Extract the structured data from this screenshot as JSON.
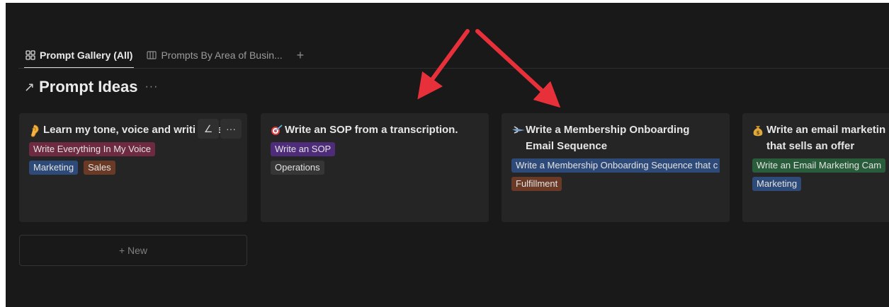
{
  "tabs": [
    {
      "label": "Prompt Gallery (All)",
      "icon": "gallery-icon",
      "active": true
    },
    {
      "label": "Prompts By Area of Busin...",
      "icon": "board-icon",
      "active": false
    }
  ],
  "add_tab_label": "+",
  "view_title": "Prompt Ideas",
  "view_title_icon": "↗",
  "view_more": "···",
  "cards": [
    {
      "emoji": "ear-icon",
      "title": "Learn my tone, voice and writi style",
      "tags": [
        [
          "Write Everything In My Voice"
        ],
        [
          "Marketing",
          "Sales"
        ]
      ]
    },
    {
      "emoji": "target-icon",
      "title": "Write an SOP from a transcription.",
      "tags": [
        [
          "Write an SOP"
        ],
        [
          "Operations"
        ]
      ]
    },
    {
      "emoji": "flying-icon",
      "title": "Write a Membership Onboarding Email Sequence",
      "tags": [
        [
          "Write a Membership Onboarding Sequence that c"
        ],
        [
          "Fulfillment"
        ]
      ]
    },
    {
      "emoji": "money-bag-icon",
      "title": "Write an email marketin that sells an offer",
      "tags": [
        [
          "Write an Email Marketing Cam"
        ],
        [
          "Marketing"
        ]
      ]
    }
  ],
  "card_actions": {
    "edit": "∠",
    "more": "···"
  },
  "new_button_label": "+ New",
  "colors": {
    "background": "#191919",
    "card": "#252525",
    "arrow": "#e8303a",
    "tag_red": "#6e2a40",
    "tag_blue": "#2d4a78",
    "tag_brown": "#6b3a27",
    "tag_purple": "#4e2c7a",
    "tag_gray": "#363636",
    "tag_green": "#285c3a"
  }
}
